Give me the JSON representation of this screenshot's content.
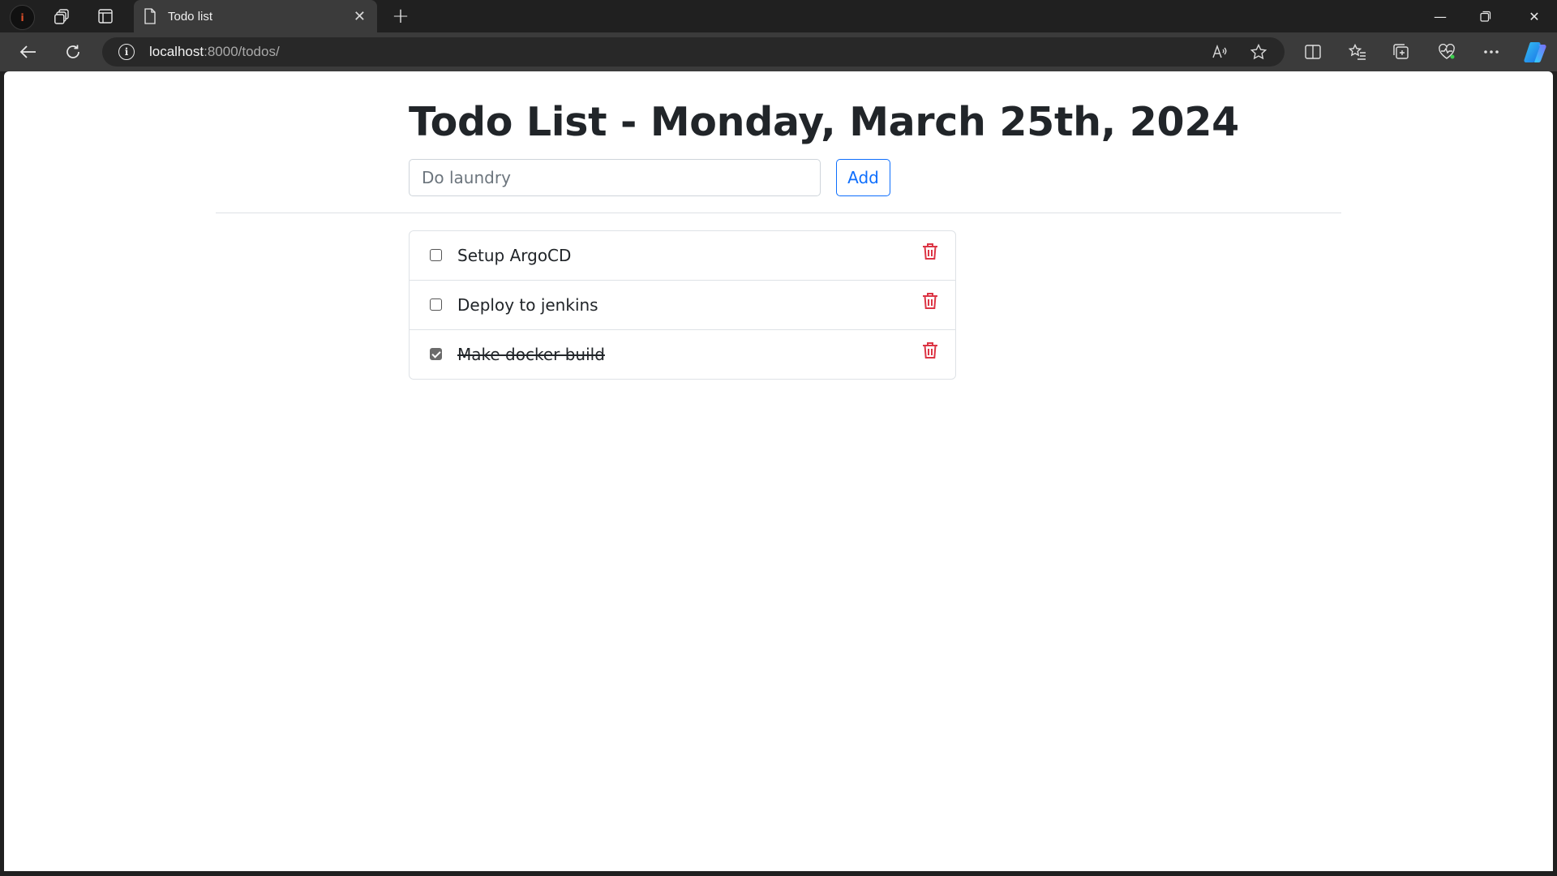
{
  "browser": {
    "tab_title": "Todo list",
    "url_host": "localhost",
    "url_rest": ":8000/todos/",
    "profile_initial": "i"
  },
  "page": {
    "title": "Todo List - Monday, March 25th, 2024",
    "input_placeholder": "Do laundry",
    "add_label": "Add"
  },
  "todos": [
    {
      "label": "Setup ArgoCD",
      "done": false
    },
    {
      "label": "Deploy to jenkins",
      "done": false
    },
    {
      "label": "Make docker build",
      "done": true
    }
  ],
  "colors": {
    "accent": "#0d6efd",
    "delete": "#dc3545",
    "text": "#212529"
  }
}
